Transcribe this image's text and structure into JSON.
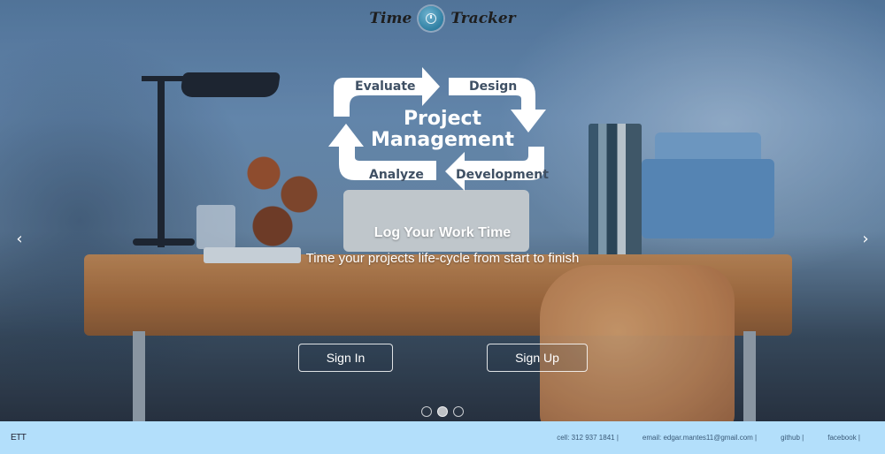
{
  "brand": {
    "word_left": "Time",
    "word_right": "Tracker"
  },
  "graphic": {
    "title_line1": "Project",
    "title_line2": "Management",
    "stages": [
      "Evaluate",
      "Design",
      "Development",
      "Analyze"
    ]
  },
  "caption": {
    "title": "Log Your Work Time",
    "subtitle": "Time your projects life-cycle from start to finish"
  },
  "actions": {
    "sign_in": "Sign In",
    "sign_up": "Sign Up"
  },
  "carousel": {
    "prev_icon": "‹",
    "next_icon": "›",
    "slides": 3,
    "active_slide": 2
  },
  "footer": {
    "brand": "ETT",
    "cell": "cell: 312 937 1841 |",
    "email": "email: edgar.mantes11@gmail.com |",
    "github": "github |",
    "facebook": "facebook |"
  },
  "colors": {
    "footer_bg": "#b3dffb",
    "logo": "#2f7fa2"
  }
}
